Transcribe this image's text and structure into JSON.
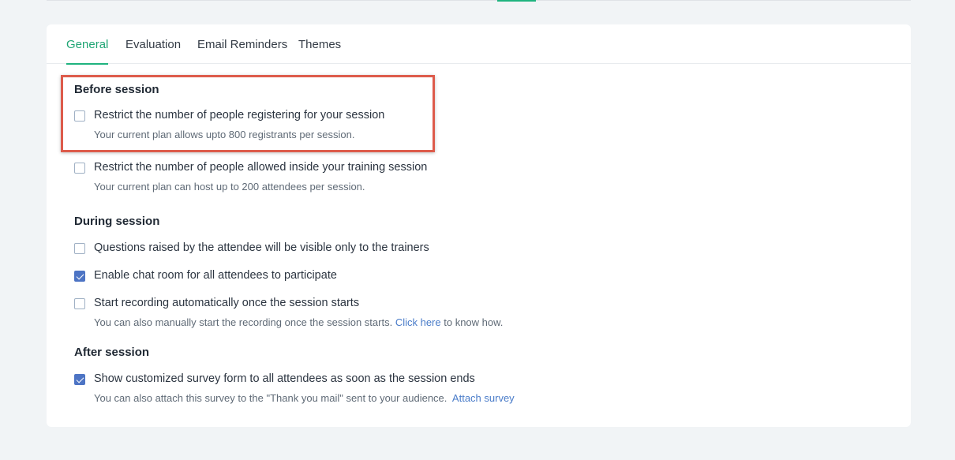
{
  "tabs": [
    {
      "label": "General",
      "active": true
    },
    {
      "label": "Evaluation",
      "active": false
    },
    {
      "label": "Email Reminders",
      "active": false
    },
    {
      "label": "Themes",
      "active": false
    }
  ],
  "sections": {
    "before": {
      "title": "Before session",
      "options": [
        {
          "label": "Restrict the number of people registering for your session",
          "help": "Your current plan allows upto 800 registrants per session.",
          "checked": false
        },
        {
          "label": "Restrict the number of people allowed inside your training session",
          "help": "Your current plan can host up to 200 attendees per session.",
          "checked": false
        }
      ]
    },
    "during": {
      "title": "During session",
      "options": [
        {
          "label": "Questions raised by the attendee will be visible only to the trainers",
          "checked": false
        },
        {
          "label": "Enable chat room for all attendees to participate",
          "checked": true
        },
        {
          "label": "Start recording automatically once the session starts",
          "help": "You can also manually start the recording once the session starts.",
          "help_link": "Click here",
          "help_suffix": "to know how.",
          "checked": false
        }
      ]
    },
    "after": {
      "title": "After session",
      "options": [
        {
          "label": "Show customized survey form to all attendees as soon as the session ends",
          "help": "You can also attach this survey to the \"Thank you mail\" sent to your audience.",
          "help_link": "Attach survey",
          "checked": true
        }
      ]
    }
  },
  "colors": {
    "accent": "#1fb37f",
    "checkbox_checked": "#4d74c4",
    "link": "#4a7cc9",
    "highlight_border": "#dd5b4b"
  }
}
